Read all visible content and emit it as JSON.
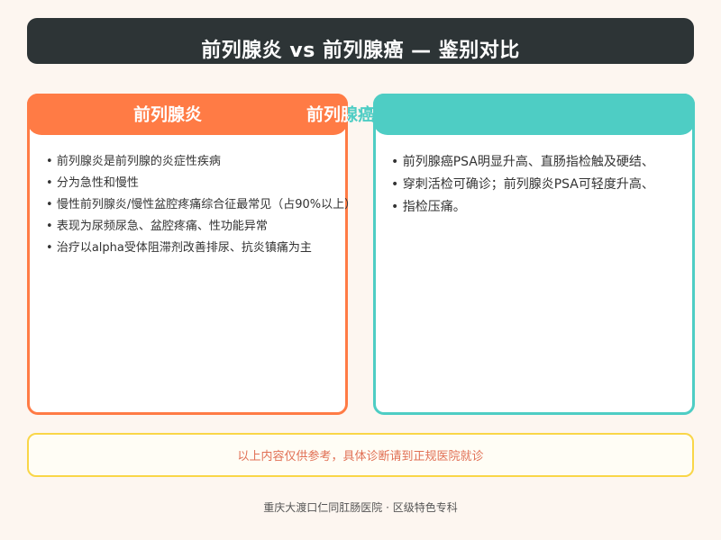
{
  "title": "前列腺炎 vs 前列腺癌 — 鉴别对比",
  "left_card": {
    "heading": "前列腺炎",
    "items": [
      "前列腺炎是前列腺的炎症性疾病",
      "分为急性和慢性",
      "慢性前列腺炎/慢性盆腔疼痛综合征最常见（占90%以上）",
      "表现为尿频尿急、盆腔疼痛、性功能异常",
      "治疗以alpha受体阻滞剂改善排尿、抗炎镇痛为主"
    ]
  },
  "right_card": {
    "heading": "前列腺癌",
    "items": [
      "前列腺癌PSA明显升高、直肠指检触及硬结、",
      "穿刺活检可确诊；前列腺炎PSA可轻度升高、",
      "指检压痛。"
    ]
  },
  "disclaimer": "以上内容仅供参考，具体诊断请到正规医院就诊",
  "footer": "重庆大渡口仁同肛肠医院 · 区级特色专科",
  "colors": {
    "title_bg": "#2d3436",
    "left_accent": "#ff7b45",
    "right_accent": "#4ecdc4",
    "disclaimer_border": "#f9d648",
    "disclaimer_text": "#e17055"
  }
}
